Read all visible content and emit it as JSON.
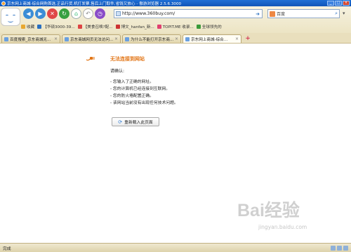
{
  "window": {
    "title": "京东网上商城-综合网购首选,正品行货,机打发票,售后上门取件,省钱又放心 - 傲游浏览器 2.5.6.3000"
  },
  "toolbar": {
    "url": "http://www.360buy.com/",
    "search_placeholder": "百度"
  },
  "favorites": [
    {
      "label": "收藏",
      "color": "#e8a830"
    },
    {
      "label": "【华硕3000-39...",
      "color": "#2a6fc0"
    },
    {
      "label": "【美食召唤?配...",
      "color": "#d44"
    },
    {
      "label": "博文_hanfan_新...",
      "color": "#c33"
    },
    {
      "label": "TOPIT.ME 收录...",
      "color": "#e04070"
    },
    {
      "label": "全球领先的",
      "color": "#3a9a3a"
    }
  ],
  "tabs": [
    {
      "label": "百度搜索_京东商城无...",
      "active": false
    },
    {
      "label": "京东商城网页无法访问...",
      "active": false
    },
    {
      "label": "为什么不能打开京东商...",
      "active": false
    },
    {
      "label": "京东网上商城-综合...",
      "active": true
    }
  ],
  "error": {
    "title": "无法连接到网站",
    "confirm": "请确认:",
    "items": [
      "- 您输入了正确的网址。",
      "- 您的计算机已经连接到互联网。",
      "- 您的防火墙配置正确。",
      "- 该网站当前没有出现任何技术问题。"
    ],
    "reload_label": "重新载入此页面"
  },
  "watermark": {
    "logo_text": "Bai经验",
    "site": "jingyan.baidu.com"
  },
  "status": {
    "text": "完成"
  },
  "colors": {
    "titlebar": "#1f6fd6",
    "error_title": "#e27414",
    "chrome": "#ece4c4"
  }
}
